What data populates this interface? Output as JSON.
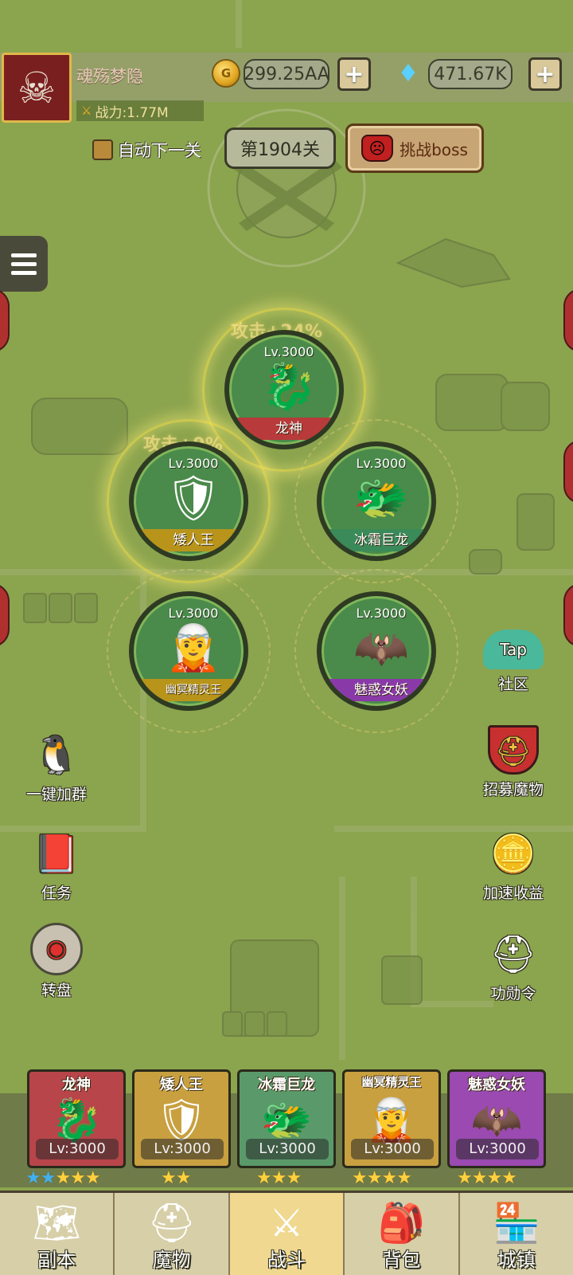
{
  "player": {
    "name": "魂殇梦隐",
    "power": "战力:1.77M"
  },
  "currency": {
    "gold": "299.25AA",
    "diamond": "471.67K"
  },
  "stage": {
    "auto_next_label": "自动下一关",
    "level": "第1904关",
    "boss_button": "挑战boss"
  },
  "bonuses": {
    "attack": "攻击+24%",
    "second": "攻击+9%"
  },
  "heroes": [
    {
      "name": "龙神",
      "level": "Lv.3000",
      "banner_color": "#b83a3a",
      "icon": "dragon"
    },
    {
      "name": "矮人王",
      "level": "Lv.3000",
      "banner_color": "#b8951a",
      "icon": "dwarf"
    },
    {
      "name": "冰霜巨龙",
      "level": "Lv.3000",
      "banner_color": "#3a8a5a",
      "icon": "frost-dragon"
    },
    {
      "name": "幽冥精灵王",
      "level": "Lv.3000",
      "banner_color": "#b8951a",
      "icon": "elf"
    },
    {
      "name": "魅惑女妖",
      "level": "Lv.3000",
      "banner_color": "#8a3aa8",
      "icon": "succubus"
    }
  ],
  "side_buttons": {
    "community": "社区",
    "community_badge": "Tap",
    "join_group": "一键加群",
    "recruit": "招募魔物",
    "tasks": "任务",
    "speed_income": "加速收益",
    "wheel": "转盘",
    "merit": "功勋令"
  },
  "team": [
    {
      "name": "龙神",
      "level": "Lv:3000",
      "bg": "#b8454a",
      "stars": 5,
      "blue_stars": 2
    },
    {
      "name": "矮人王",
      "level": "Lv:3000",
      "bg": "#c8a040",
      "stars": 2,
      "blue_stars": 0
    },
    {
      "name": "冰霜巨龙",
      "level": "Lv:3000",
      "bg": "#5a9a6a",
      "stars": 3,
      "blue_stars": 0
    },
    {
      "name": "幽冥精灵王",
      "level": "Lv:3000",
      "bg": "#c8a040",
      "stars": 4,
      "blue_stars": 0
    },
    {
      "name": "魅惑女妖",
      "level": "Lv:3000",
      "bg": "#9a4ab0",
      "stars": 4,
      "blue_stars": 0
    }
  ],
  "nav": {
    "dungeon": "副本",
    "monsters": "魔物",
    "battle": "战斗",
    "bag": "背包",
    "town": "城镇",
    "active": "battle"
  },
  "colors": {
    "map_bg": "#8ba44e",
    "accent_gold": "#e0b84a"
  }
}
